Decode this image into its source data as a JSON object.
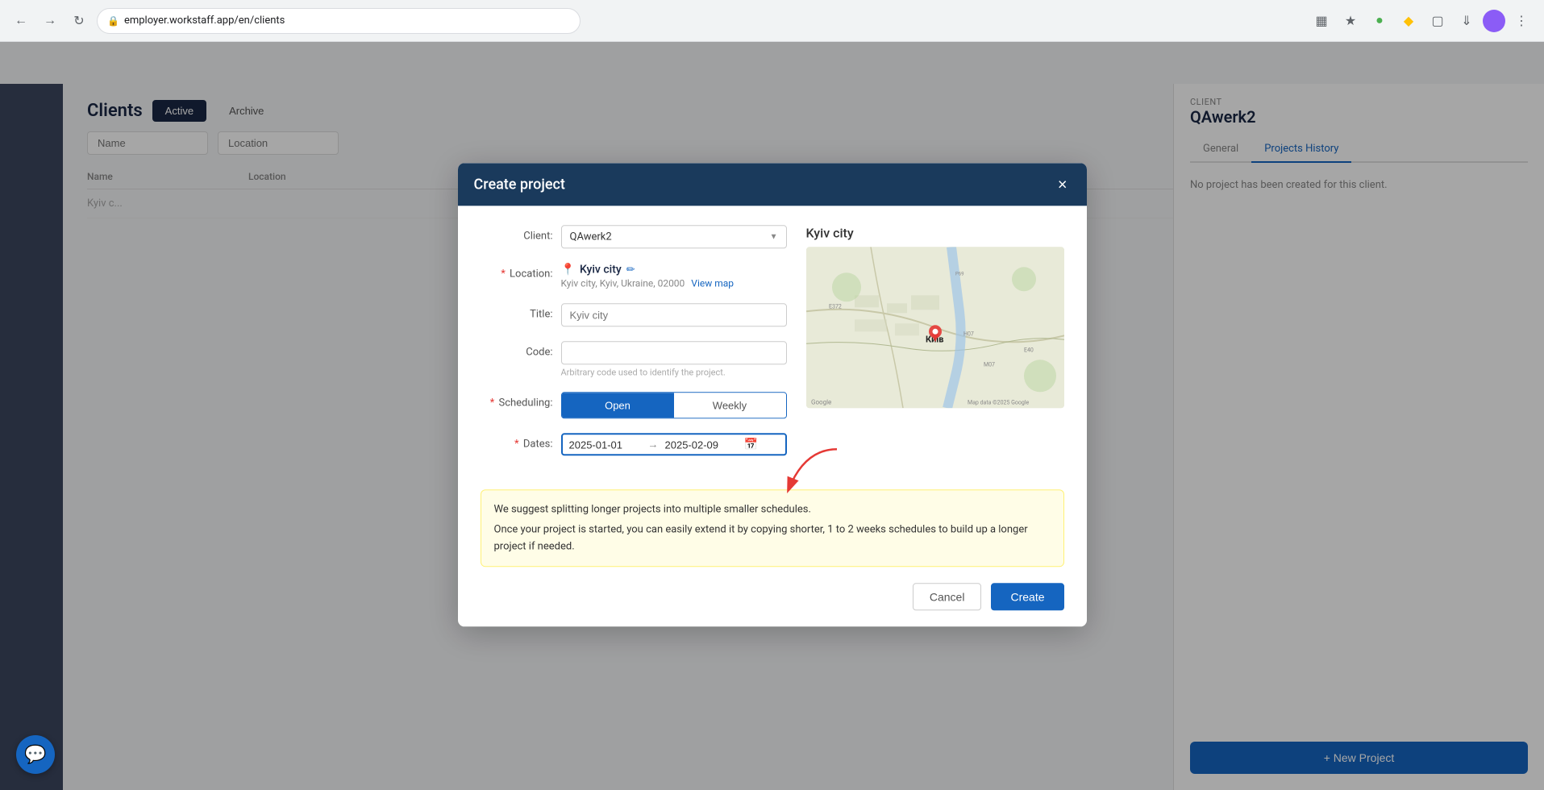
{
  "browser": {
    "url": "employer.workstaff.app/en/clients",
    "back_title": "Back",
    "forward_title": "Forward",
    "refresh_title": "Refresh"
  },
  "page": {
    "title": "Clients",
    "tabs": [
      {
        "label": "Active",
        "active": true
      },
      {
        "label": "Archive",
        "active": false
      }
    ],
    "search_name_placeholder": "Name",
    "search_location_placeholder": "Location",
    "table_headers": [
      "Name",
      "Location"
    ],
    "table_rows": [
      {
        "name": "Kyiv c...",
        "location": ""
      }
    ]
  },
  "right_panel": {
    "client_label": "CLIENT",
    "client_name": "QAwerk2",
    "tabs": [
      {
        "label": "General",
        "active": false
      },
      {
        "label": "Projects History",
        "active": true
      }
    ],
    "no_project_text": "No project has been created for this client.",
    "new_project_btn": "+ New Project"
  },
  "modal": {
    "title": "Create project",
    "close_label": "×",
    "client_label": "Client:",
    "client_value": "QAwerk2",
    "location_label": "Location:",
    "location_name": "Kyiv city",
    "location_edit_icon": "✏",
    "location_address": "Kyiv city, Kyiv, Ukraine, 02000",
    "view_map_label": "View map",
    "title_label": "Title:",
    "title_placeholder": "Kyiv city",
    "code_label": "Code:",
    "code_placeholder": "",
    "code_hint": "Arbitrary code used to identify the project.",
    "scheduling_label": "Scheduling:",
    "scheduling_options": [
      {
        "label": "Open",
        "active": true
      },
      {
        "label": "Weekly",
        "active": false
      }
    ],
    "dates_label": "Dates:",
    "date_start": "2025-01-01",
    "date_end": "2025-02-09",
    "map_title": "Kyiv city",
    "warning_text_1": "We suggest splitting longer projects into multiple smaller schedules.",
    "warning_text_2": "Once your project is started, you can easily extend it by copying shorter, 1 to 2 weeks schedules to build up a longer project if needed.",
    "cancel_label": "Cancel",
    "create_label": "Create"
  },
  "chat": {
    "icon": "💬"
  }
}
